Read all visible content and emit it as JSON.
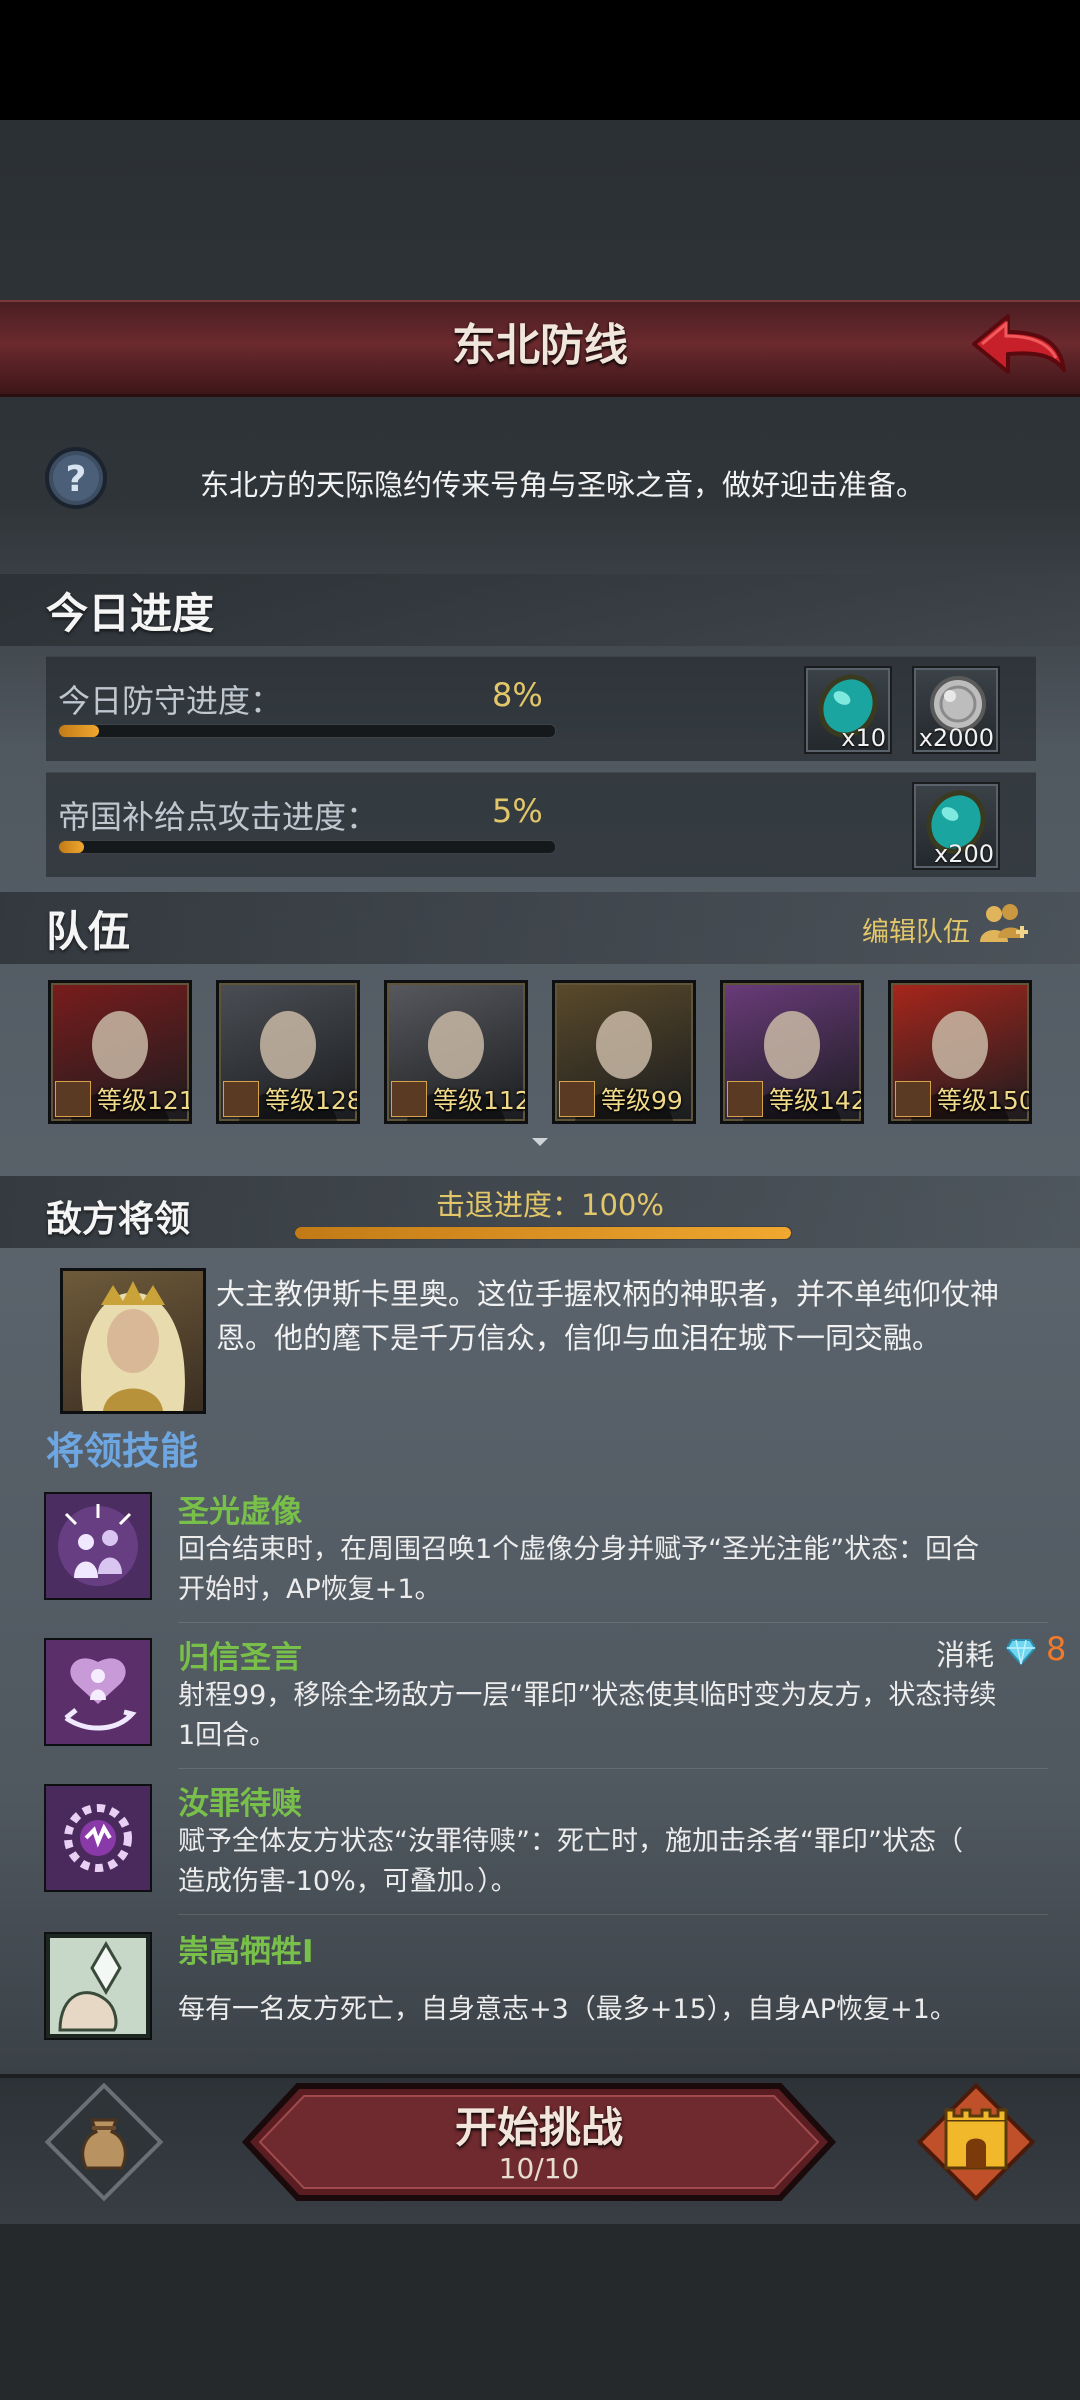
{
  "header": {
    "title": "东北防线"
  },
  "description": "东北方的天际隐约传来号角与圣咏之音，做好迎击准备。",
  "progress": {
    "heading": "今日进度",
    "rows": [
      {
        "label": "今日防守进度：",
        "percent_text": "8%",
        "value": 0.08,
        "rewards": [
          {
            "icon": "turquoise-gem-icon",
            "qty": "x10"
          },
          {
            "icon": "silver-coin-icon",
            "qty": "x2000"
          }
        ]
      },
      {
        "label": "帝国补给点攻击进度：",
        "percent_text": "5%",
        "value": 0.05,
        "rewards": [
          {
            "icon": "turquoise-gem-icon",
            "qty": "x200"
          }
        ]
      }
    ]
  },
  "team": {
    "heading": "队伍",
    "edit_label": "编辑队伍",
    "heroes": [
      {
        "name": "hooded-assassin",
        "level": "等级121",
        "color": "#7a1c1c"
      },
      {
        "name": "silver-elf-mage",
        "level": "等级128",
        "color": "#4b4e54"
      },
      {
        "name": "white-elf-mage",
        "level": "等级112",
        "color": "#57595e"
      },
      {
        "name": "silver-haired-knight",
        "level": "等级99",
        "color": "#5a4a2a"
      },
      {
        "name": "purple-bird-beast",
        "level": "等级142",
        "color": "#6a3b7a"
      },
      {
        "name": "gift-box-jester",
        "level": "等级150",
        "color": "#a8261c"
      }
    ]
  },
  "enemy": {
    "heading": "敌方将领",
    "repel_label": "击退进度：100%",
    "repel_value": 1.0,
    "bio": [
      "大主教伊斯卡里奥。这位手握权柄的神职者，并不单纯仰仗神",
      "恩。他的麾下是千万信众，信仰与血泪在城下一同交融。"
    ]
  },
  "skills": {
    "heading": "将领技能",
    "cost_label": "消耗",
    "cost_value": "8",
    "items": [
      {
        "name": "圣光虚像",
        "icon": "holy-mirage-icon",
        "desc": [
          "回合结束时，在周围召唤1个虚像分身并赋予“圣光注能”状态：回合",
          "开始时，AP恢复+1。"
        ]
      },
      {
        "name": "归信圣言",
        "icon": "conversion-word-icon",
        "desc": [
          "射程99，移除全场敌方一层“罪印”状态使其临时变为友方，状态持续",
          "1回合。"
        ]
      },
      {
        "name": "汝罪待赎",
        "icon": "sin-atonement-icon",
        "desc": [
          "赋予全体友方状态“汝罪待赎”：死亡时，施加击杀者“罪印”状态（",
          "造成伤害-10%，可叠加。）。"
        ]
      },
      {
        "name": "崇高牺牲I",
        "icon": "noble-sacrifice-icon",
        "desc": [
          "每有一名友方死亡，自身意志+3（最多+15），自身AP恢复+1。"
        ]
      }
    ]
  },
  "footer": {
    "start_label": "开始挑战",
    "attempts": "10/10"
  }
}
